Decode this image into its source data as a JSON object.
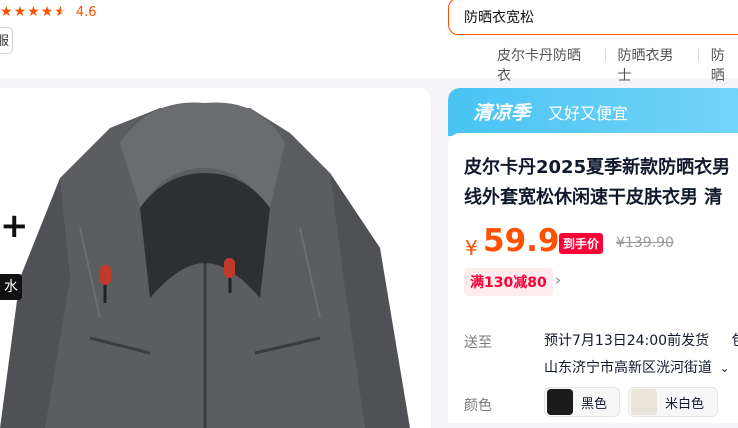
{
  "header": {
    "rating_value": "4.6",
    "shop_button": "服",
    "search_value": "防晒衣宽松",
    "hot_searches": [
      "皮尔卡丹防晒衣",
      "防晒衣男士",
      "防晒"
    ]
  },
  "image_panel": {
    "overlay_plus": "+",
    "overlay_badge": "水",
    "jacket_color": "#5b5d60"
  },
  "banner": {
    "brand": "清凉季",
    "slogan": "又好又便宜",
    "color": "#49c4f3"
  },
  "product": {
    "title_line1": "皮尔卡丹2025夏季新款防晒衣男",
    "title_line2": "线外套宽松休闲速干皮肤衣男 清",
    "price_symbol": "¥",
    "price": "59.9",
    "price_tag": "到手价",
    "original_price": "¥139.90",
    "coupon": "满130减80",
    "accent_color": "#ff5000"
  },
  "shipping": {
    "label": "送至",
    "eta": "预计7月13日24:00前发货",
    "extra": "包邮",
    "address": "山东济宁市高新区洸河街道"
  },
  "colors": {
    "label": "颜色",
    "options": [
      {
        "name": "黑色",
        "swatch": "#1b1b1b"
      },
      {
        "name": "米白色",
        "swatch": "#e9e4d8"
      }
    ]
  }
}
